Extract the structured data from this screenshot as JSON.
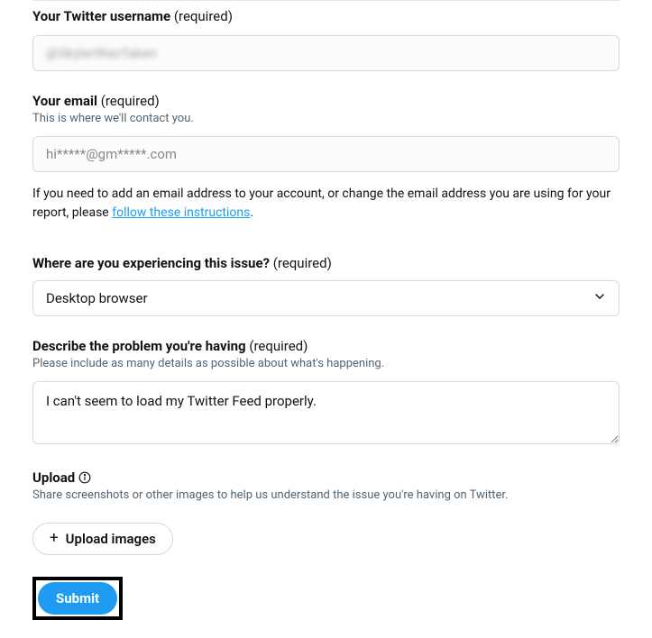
{
  "username": {
    "label": "Your Twitter username",
    "required": "(required)",
    "value": "@SkylerWasTaken"
  },
  "email": {
    "label": "Your email",
    "required": "(required)",
    "helper": "This is where we'll contact you.",
    "value": "hi*****@gm*****.com",
    "note_prefix": "If you need to add an email address to your account, or change the email address you are using for your report, please ",
    "note_link": "follow these instructions",
    "note_suffix": "."
  },
  "issue_location": {
    "label": "Where are you experiencing this issue?",
    "required": "(required)",
    "value": "Desktop browser"
  },
  "describe": {
    "label": "Describe the problem you're having",
    "required": "(required)",
    "helper": "Please include as many details as possible about what's happening.",
    "value": "I can't seem to load my Twitter Feed properly."
  },
  "upload": {
    "label": "Upload",
    "helper": "Share screenshots or other images to help us understand the issue you're having on Twitter.",
    "button": "Upload images"
  },
  "submit": {
    "label": "Submit"
  }
}
